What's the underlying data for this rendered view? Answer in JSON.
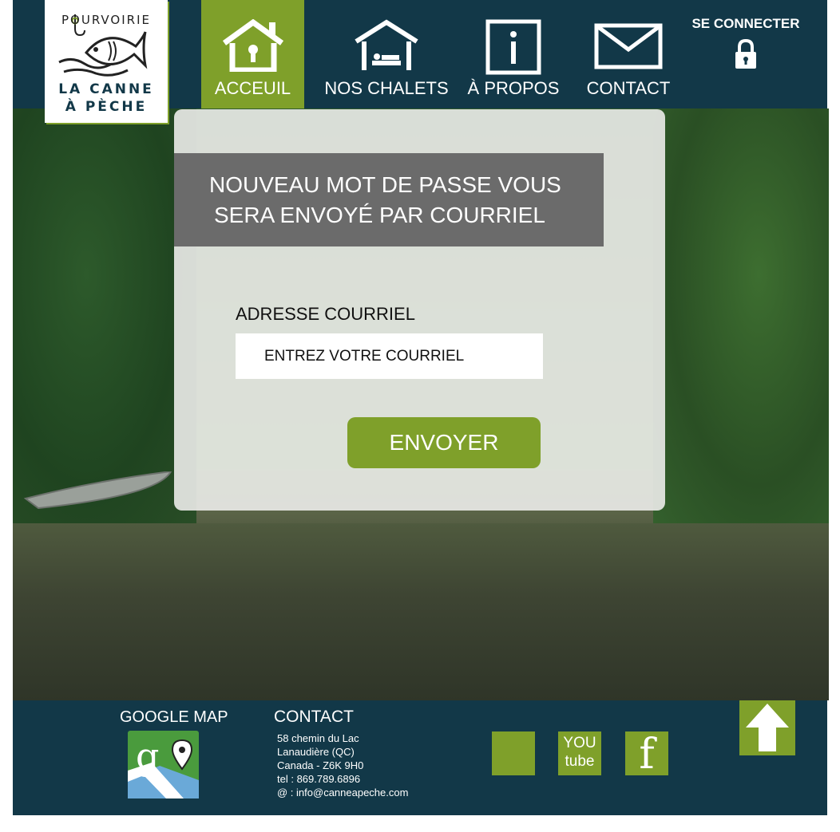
{
  "logo": {
    "line1": "POURVOIRIE",
    "line2": "LA CANNE",
    "line3": "À PÈCHE"
  },
  "nav": {
    "items": [
      {
        "label": "ACCEUIL",
        "icon": "house-icon",
        "active": true
      },
      {
        "label": "NOS CHALETS",
        "icon": "bed-house-icon",
        "active": false
      },
      {
        "label": "À PROPOS",
        "icon": "info-icon",
        "active": false
      },
      {
        "label": "CONTACT",
        "icon": "envelope-icon",
        "active": false
      }
    ],
    "login_label": "SE CONNECTER",
    "login_icon": "lock-icon"
  },
  "form": {
    "banner_line1": "NOUVEAU MOT DE PASSE VOUS",
    "banner_line2": "SERA ENVOYÉ PAR COURRIEL",
    "email_label": "ADRESSE COURRIEL",
    "email_placeholder": "ENTREZ VOTRE COURRIEL",
    "submit_label": "ENVOYER"
  },
  "footer": {
    "map_title": "GOOGLE MAP",
    "map_icon": "google-maps-icon",
    "contact_title": "CONTACT",
    "contact_lines": [
      "58 chemin du Lac",
      "Lanaudière (QC)",
      "Canada - Z6K 9H0",
      "tel : 869.789.6896",
      "@ : info@canneapeche.com"
    ],
    "youtube_line1": "YOU",
    "youtube_line2": "tube",
    "facebook_glyph": "f",
    "scroll_top_icon": "arrow-up-icon"
  },
  "colors": {
    "navy": "#123848",
    "green": "#7fa02a",
    "banner_gray": "#6b6b6b"
  }
}
